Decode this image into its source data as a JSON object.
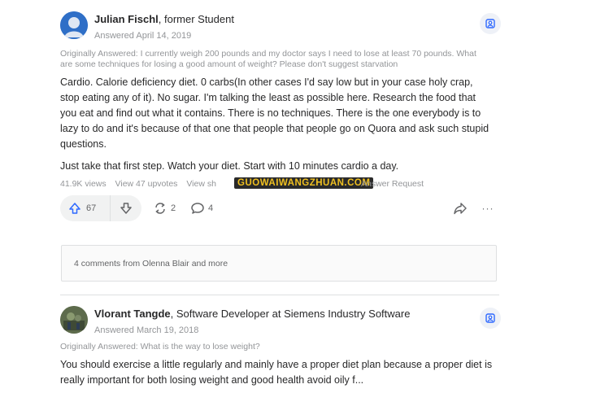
{
  "answers": [
    {
      "author_name": "Julian Fischl",
      "author_credential": ", former Student",
      "date": "Answered April 14, 2019",
      "original_question": "Originally Answered: I currently weigh 200 pounds and my doctor says I need to lose at least 70 pounds. What are some techniques for losing a good amount of weight? Please don't suggest starvation",
      "paragraphs": [
        "Cardio. Calorie deficiency diet. 0 carbs(In other cases I'd say low but in your case holy crap, stop eating any of it). No sugar. I'm talking the least as possible here. Research the food that you eat and find out what it contains. There is no techniques. There is the one everybody is to lazy to do and it's because of that one that people that people go on Quora and ask such stupid questions.",
        "Just take that first step. Watch your diet. Start with 10 minutes cardio a day."
      ],
      "views": "41.9K views",
      "upvotes_view": "View 47 upvotes",
      "shares_view": "View sh",
      "share_hint": "Answer Request",
      "upvote_count": "67",
      "share_count": "2",
      "comment_count": "4",
      "more_label": "···",
      "comments_label": "4 comments from Olenna Blair and more"
    },
    {
      "author_name": "Vlorant Tangde",
      "author_credential": ", Software Developer at Siemens Industry Software",
      "date": "Answered March 19, 2018",
      "original_question": "Originally Answered: What is the way to lose weight?",
      "paragraphs": [
        "You should exercise a little regularly and mainly have a proper diet plan because a proper diet is really important for both losing weight and good health avoid oily f..."
      ]
    }
  ],
  "watermark": "GUOWAIWANGZHUAN.COM",
  "colors": {
    "upvote_blue": "#2e69ff",
    "muted_text": "#939598",
    "body_text": "#282829",
    "watermark_yellow": "#f0c020"
  }
}
